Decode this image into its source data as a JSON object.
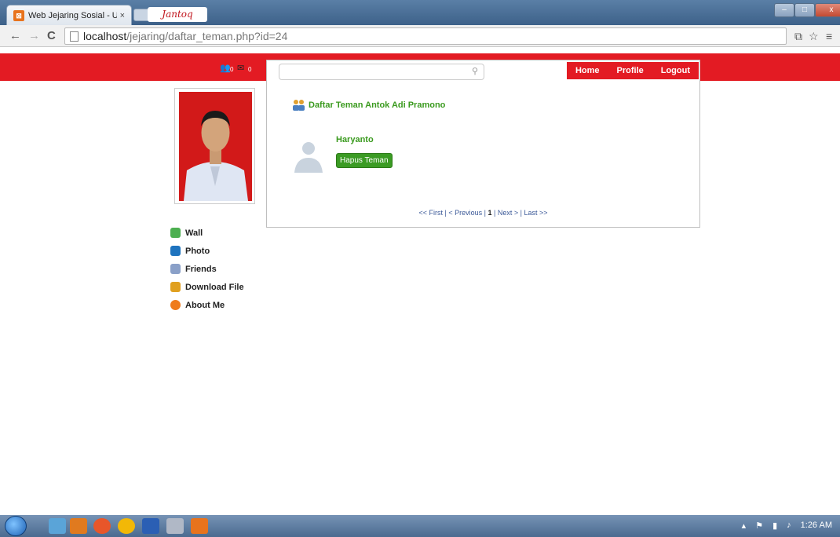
{
  "browser": {
    "tab_title": "Web Jejaring Sosial - UNT",
    "tab_close": "×",
    "url_host": "localhost",
    "url_path": "/jejaring/daftar_teman.php?id=24",
    "back": "←",
    "forward": "→",
    "reload": "C"
  },
  "header": {
    "logo_text": "Jantoq",
    "friend_requests": "0",
    "messages": "0",
    "search_placeholder": "",
    "nav": [
      "Home",
      "Profile",
      "Logout"
    ]
  },
  "sidebar": {
    "items": [
      {
        "label": "Wall",
        "icon": "wall-icon",
        "color": "#4caf50"
      },
      {
        "label": "Photo",
        "icon": "photo-icon",
        "color": "#1e73be"
      },
      {
        "label": "Friends",
        "icon": "friends-icon",
        "color": "#8aa0c8"
      },
      {
        "label": "Download File",
        "icon": "download-icon",
        "color": "#e0a020"
      },
      {
        "label": "About Me",
        "icon": "about-icon",
        "color": "#ef7b1c"
      }
    ]
  },
  "main": {
    "title": "Daftar Teman Antok Adi Pramono",
    "friends": [
      {
        "name": "Haryanto",
        "action": "Hapus Teman"
      }
    ],
    "pager": {
      "first": "<< First",
      "previous": "< Previous",
      "current": "1",
      "next": "Next >",
      "last": "Last >>"
    }
  },
  "taskbar": {
    "time": "1:26 AM"
  },
  "colors": {
    "brand": "#e31b23",
    "accent_green": "#3a9a1e"
  }
}
